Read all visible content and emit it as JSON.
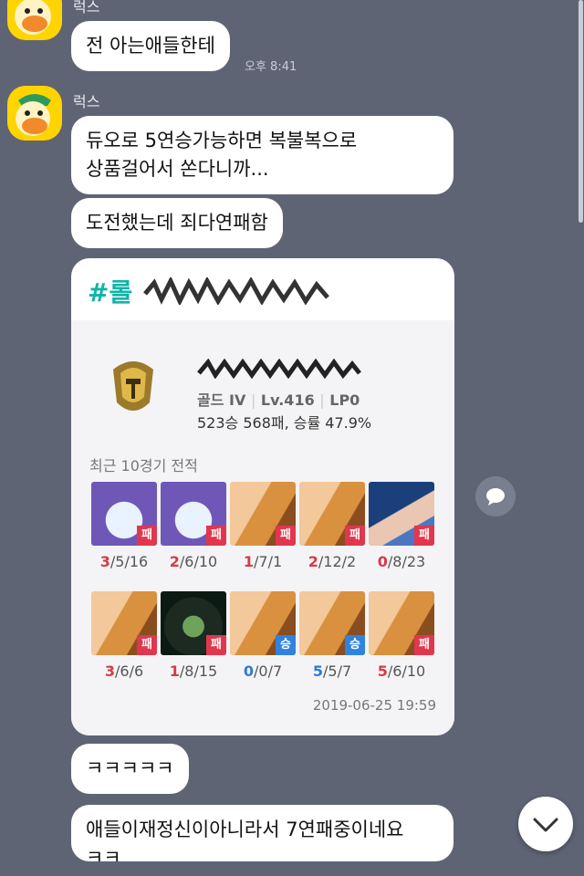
{
  "messages": [
    {
      "sender": "럭스",
      "text": "전 아는애들한테",
      "time": "오후 8:41"
    },
    {
      "sender": "럭스",
      "text": "듀오로 5연승가능하면 복불복으로\n상품걸어서 쏜다니까..."
    },
    {
      "text": "도전했는데 죄다연패함"
    },
    {
      "text": "ㅋㅋㅋㅋㅋ"
    },
    {
      "text": "애들이재정신이아니라서 7연패중이네요\nㅋㅋ"
    }
  ],
  "card": {
    "hashtag": "#롤",
    "rank": "골드 IV",
    "level": "Lv.416",
    "lp": "LP0",
    "separator": "|",
    "record": "523승 568패, 승률 47.9%",
    "recent_label": "최근 10경기 전적",
    "date": "2019-06-25 19:59",
    "colors": {
      "lose": "#e0374e",
      "win": "#2f82de",
      "hashtag": "#12b3a8"
    },
    "matches": [
      {
        "result": "패",
        "k": "3",
        "rest": "/5/16",
        "win": false,
        "champion_icon": "yuumi-portrait"
      },
      {
        "result": "패",
        "k": "2",
        "rest": "/6/10",
        "win": false,
        "champion_icon": "yuumi-portrait"
      },
      {
        "result": "패",
        "k": "1",
        "rest": "/7/1",
        "win": false,
        "champion_icon": "lux-portrait"
      },
      {
        "result": "패",
        "k": "2",
        "rest": "/12/2",
        "win": false,
        "champion_icon": "lux-portrait"
      },
      {
        "result": "패",
        "k": "0",
        "rest": "/8/23",
        "win": false,
        "champion_icon": "blue-hair-champion-portrait"
      },
      {
        "result": "패",
        "k": "3",
        "rest": "/6/6",
        "win": false,
        "champion_icon": "lux-portrait"
      },
      {
        "result": "패",
        "k": "1",
        "rest": "/8/15",
        "win": false,
        "champion_icon": "dark-champion-portrait"
      },
      {
        "result": "승",
        "k": "0",
        "rest": "/0/7",
        "win": true,
        "champion_icon": "lux-portrait"
      },
      {
        "result": "승",
        "k": "5",
        "rest": "/5/7",
        "win": true,
        "champion_icon": "lux-portrait"
      },
      {
        "result": "패",
        "k": "5",
        "rest": "/6/10",
        "win": false,
        "champion_icon": "lux-portrait"
      }
    ]
  },
  "icons": {
    "avatar": "duck-avatar-icon",
    "side": "chat-bubble-icon",
    "scroll": "chevron-down-icon"
  }
}
